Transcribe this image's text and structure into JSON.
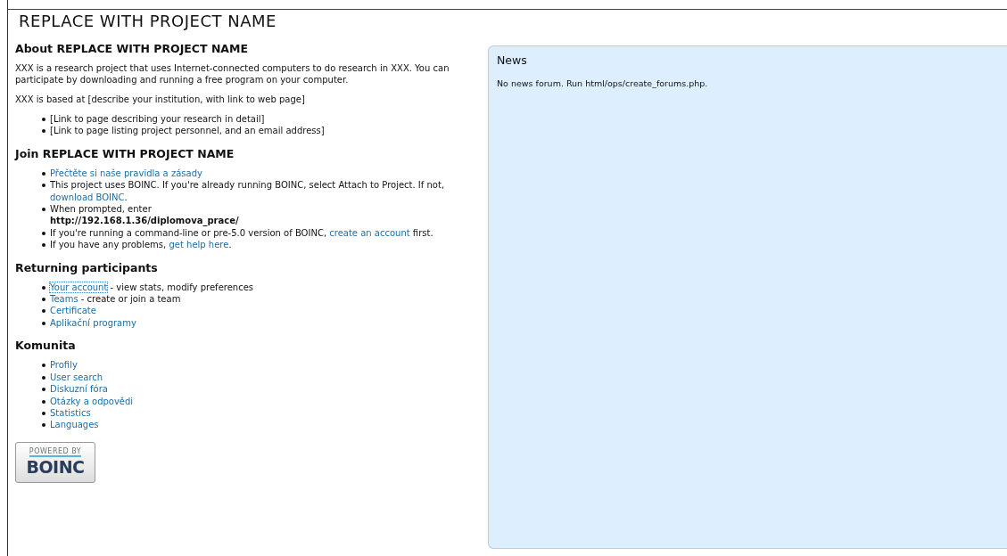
{
  "title": "REPLACE WITH PROJECT NAME",
  "sections": [
    {
      "heading": "About REPLACE WITH PROJECT NAME",
      "paragraphs": [
        "XXX is a research project that uses Internet-connected computers to do research in XXX. You can participate by downloading and running a free program on your computer.",
        "XXX is based at [describe your institution, with link to web page]"
      ],
      "items": [
        {
          "parts": [
            {
              "kind": "text",
              "text": "[Link to page describing your research in detail]"
            }
          ]
        },
        {
          "parts": [
            {
              "kind": "text",
              "text": "[Link to page listing project personnel, and an email address]"
            }
          ]
        }
      ]
    },
    {
      "heading": "Join REPLACE WITH PROJECT NAME",
      "items": [
        {
          "parts": [
            {
              "kind": "link",
              "text": "Přečtěte si naše pravidla a zásady",
              "focused": false
            }
          ]
        },
        {
          "parts": [
            {
              "kind": "text",
              "text": "This project uses BOINC. If you're already running BOINC, select Attach to Project. If not, "
            },
            {
              "kind": "link",
              "text": "download BOINC",
              "focused": false
            },
            {
              "kind": "text",
              "text": "."
            }
          ]
        },
        {
          "parts": [
            {
              "kind": "text",
              "text": "When prompted, enter"
            },
            {
              "kind": "url",
              "text": "http://192.168.1.36/diplomova_prace/"
            }
          ]
        },
        {
          "parts": [
            {
              "kind": "text",
              "text": "If you're running a command-line or pre-5.0 version of BOINC, "
            },
            {
              "kind": "link",
              "text": "create an account",
              "focused": false
            },
            {
              "kind": "text",
              "text": " first."
            }
          ]
        },
        {
          "parts": [
            {
              "kind": "text",
              "text": "If you have any problems, "
            },
            {
              "kind": "link",
              "text": "get help here",
              "focused": false
            },
            {
              "kind": "text",
              "text": "."
            }
          ]
        }
      ]
    },
    {
      "heading": "Returning participants",
      "items": [
        {
          "parts": [
            {
              "kind": "link",
              "text": "Your account",
              "focused": true
            },
            {
              "kind": "text",
              "text": " - view stats, modify preferences"
            }
          ]
        },
        {
          "parts": [
            {
              "kind": "link",
              "text": "Teams",
              "focused": false
            },
            {
              "kind": "text",
              "text": " - create or join a team"
            }
          ]
        },
        {
          "parts": [
            {
              "kind": "link",
              "text": "Certificate",
              "focused": false
            }
          ]
        },
        {
          "parts": [
            {
              "kind": "link",
              "text": "Aplikační programy",
              "focused": false
            }
          ]
        }
      ]
    },
    {
      "heading": "Komunita",
      "items": [
        {
          "parts": [
            {
              "kind": "link",
              "text": "Profily",
              "focused": false
            }
          ]
        },
        {
          "parts": [
            {
              "kind": "link",
              "text": "User search",
              "focused": false
            }
          ]
        },
        {
          "parts": [
            {
              "kind": "link",
              "text": "Diskuzní fóra",
              "focused": false
            }
          ]
        },
        {
          "parts": [
            {
              "kind": "link",
              "text": "Otázky a odpovědi",
              "focused": false
            }
          ]
        },
        {
          "parts": [
            {
              "kind": "link",
              "text": "Statistics",
              "focused": false
            }
          ]
        },
        {
          "parts": [
            {
              "kind": "link",
              "text": "Languages",
              "focused": false
            }
          ]
        }
      ]
    }
  ],
  "badge": {
    "caption": "POWERED BY",
    "word": "BOINC"
  },
  "news": {
    "heading": "News",
    "text": "No news forum. Run html/ops/create_forums.php."
  }
}
